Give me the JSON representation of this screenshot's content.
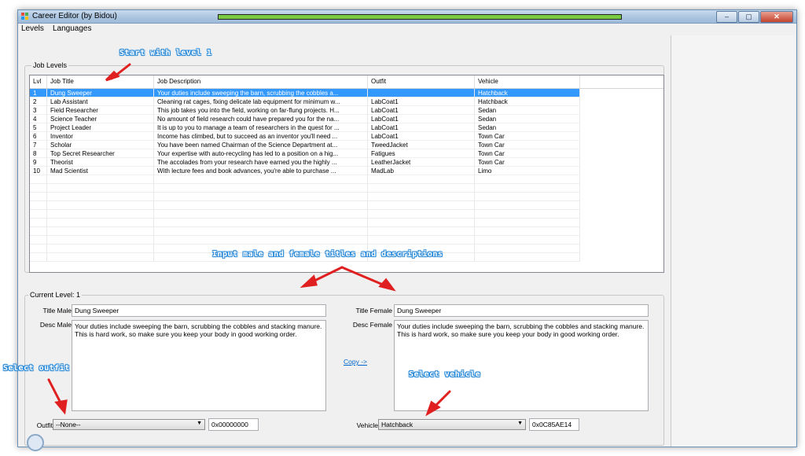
{
  "window": {
    "title": "Career Editor (by Bidou)",
    "progress": 1.0,
    "buttons": {
      "minimize": "–",
      "maximize": "▢",
      "close": "✕"
    }
  },
  "menu": [
    "Levels",
    "Languages"
  ],
  "job_levels": {
    "group_label": "Job Levels",
    "columns": [
      "Lvl",
      "Job Title",
      "Job Description",
      "Outfit",
      "Vehicle"
    ],
    "rows": [
      [
        "1",
        "Dung Sweeper",
        "Your duties include sweeping the barn, scrubbing the cobbles a...",
        "",
        "Hatchback"
      ],
      [
        "2",
        "Lab Assistant",
        "Cleaning rat cages, fixing delicate lab equipment for minimum w...",
        "LabCoat1",
        "Hatchback"
      ],
      [
        "3",
        "Field Researcher",
        "This job takes you into the field, working on far-flung projects. H...",
        "LabCoat1",
        "Sedan"
      ],
      [
        "4",
        "Science Teacher",
        "No amount of field research could have prepared you for the na...",
        "LabCoat1",
        "Sedan"
      ],
      [
        "5",
        "Project Leader",
        "It is up to you to manage a team of researchers in the quest for ...",
        "LabCoat1",
        "Sedan"
      ],
      [
        "6",
        "Inventor",
        "Income has climbed, but to succeed as an inventor you'll need ...",
        "LabCoat1",
        "Town Car"
      ],
      [
        "7",
        "Scholar",
        "You have been named Chairman of the Science Department at...",
        "TweedJacket",
        "Town Car"
      ],
      [
        "8",
        "Top Secret Researcher",
        "Your expertise with auto-recycling has led to a position on a hig...",
        "Fatigues",
        "Town Car"
      ],
      [
        "9",
        "Theorist",
        "The accolades from your research have earned you the highly ...",
        "LeatherJacket",
        "Town Car"
      ],
      [
        "10",
        "Mad Scientist",
        "With lecture fees and book advances, you're able to purchase ...",
        "MadLab",
        "Limo"
      ]
    ],
    "selected_row": 0
  },
  "current_level": {
    "group_label": "Current Level: 1",
    "title_male_label": "Title Male",
    "title_male": "Dung Sweeper",
    "desc_male_label": "Desc Male",
    "desc_male": "Your duties include sweeping the barn, scrubbing the cobbles and stacking manure. This is hard work, so make sure you keep your body in good working order.",
    "title_female_label": "Title Female",
    "title_female": "Dung Sweeper",
    "desc_female_label": "Desc Female",
    "desc_female": "Your duties include sweeping the barn, scrubbing the cobbles and stacking manure. This is hard work, so make sure you keep your body in good working order.",
    "copy_link": "Copy ->",
    "outfit_label": "Outfit",
    "outfit_value": "--None--",
    "outfit_hex": "0x00000000",
    "vehicle_label": "Vehicle",
    "vehicle_value": "Hatchback",
    "vehicle_hex": "0x0C85AE14"
  },
  "annotations": {
    "start": "Start with level 1",
    "input": "Input male and female titles and descriptions",
    "outfit": "Select outfit",
    "vehicle": "Select vehicle"
  },
  "colors": {
    "selection": "#3399ff",
    "annotation_outline": "#2a8ad8",
    "arrow": "#e02020"
  }
}
